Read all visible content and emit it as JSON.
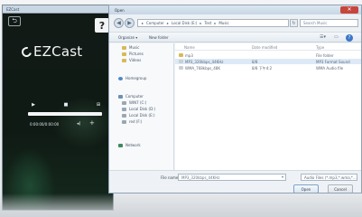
{
  "ezcast": {
    "window_title": "EZCast",
    "logo_text": "EZCast",
    "back_glyph": "⮌",
    "help_glyph": "?",
    "controls": [
      "▶",
      "■",
      "⊞"
    ],
    "time": "0:00:00/0:00:00",
    "volume_icon": "speaker-icon",
    "volume_plus": "+"
  },
  "dialog": {
    "title": "Open",
    "close_glyph": "✕",
    "address_path": [
      "Computer",
      "Local Disk (E:)",
      "Test",
      "Music"
    ],
    "search_placeholder": "Search Music",
    "toolbar": {
      "organize": "Organize ▾",
      "new_folder": "New folder"
    },
    "nav_items": [
      {
        "label": "Music",
        "icon": "folder-icon",
        "group": "libraries"
      },
      {
        "label": "Pictures",
        "icon": "folder-icon",
        "group": "libraries"
      },
      {
        "label": "Videos",
        "icon": "folder-icon",
        "group": "libraries"
      },
      {
        "label": "Homegroup",
        "icon": "homegroup-icon",
        "group": "homegroup"
      },
      {
        "label": "Computer",
        "icon": "computer-icon",
        "group": "computer"
      },
      {
        "label": "WIN7 (C:)",
        "icon": "drive-icon",
        "group": "computer"
      },
      {
        "label": "Local Disk (D:)",
        "icon": "drive-icon",
        "group": "computer"
      },
      {
        "label": "Local Disk (E:)",
        "icon": "drive-icon",
        "group": "computer"
      },
      {
        "label": "red (F:)",
        "icon": "drive-icon",
        "group": "computer"
      },
      {
        "label": "Network",
        "icon": "network-icon",
        "group": "network"
      }
    ],
    "columns": {
      "name": "Name",
      "date": "Date modified",
      "type": "Type"
    },
    "files": [
      {
        "name": "mp3",
        "date": "",
        "type": "File folder",
        "icon": "folder-icon",
        "selected": false
      },
      {
        "name": "MP3_320kbps_44KHz",
        "date": "8/8",
        "type": "MP3 Format Sound",
        "icon": "audio-file-icon",
        "selected": true
      },
      {
        "name": "WMA_768kbps_48K",
        "date": "8/8  下午4:2",
        "type": "WMA Audio file",
        "icon": "audio-file-icon",
        "selected": false
      }
    ],
    "file_name_label": "File name:",
    "file_name_value": "MP3_320kbps_44KHz",
    "filter": "Audio Files (*.mp3,*.wma,*...)",
    "open_label": "Open",
    "cancel_label": "Cancel"
  }
}
